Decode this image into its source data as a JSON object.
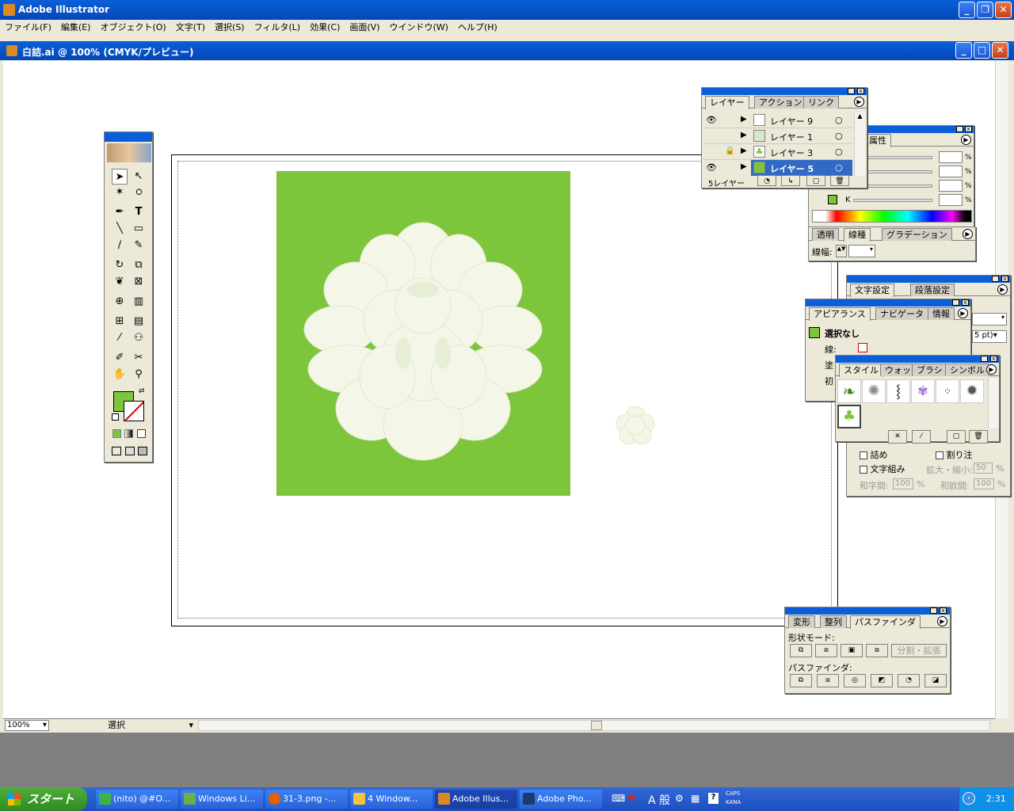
{
  "app": {
    "title": "Adobe Illustrator"
  },
  "menu": [
    "ファイル(F)",
    "編集(E)",
    "オブジェクト(O)",
    "文字(T)",
    "選択(S)",
    "フィルタ(L)",
    "効果(C)",
    "画面(V)",
    "ウインドウ(W)",
    "ヘルプ(H)"
  ],
  "document": {
    "title": "白詰.ai @ 100% (CMYK/プレビュー)"
  },
  "colors": {
    "artboard_green": "#7dc53b",
    "flower": "#f4f7e8",
    "titlebar": "#0a5fd8",
    "taskbar": "#245edb"
  },
  "layers": {
    "tabs": [
      "レイヤー",
      "アクション",
      "リンク"
    ],
    "rows": [
      {
        "name": "レイヤー 9",
        "visible": true,
        "locked": false
      },
      {
        "name": "レイヤー 1",
        "visible": false,
        "locked": false
      },
      {
        "name": "レイヤー 3",
        "visible": false,
        "locked": true
      },
      {
        "name": "レイヤー 5",
        "visible": true,
        "locked": false,
        "selected": true
      }
    ],
    "count": "5レイヤー"
  },
  "color_panel": {
    "tab": "属性",
    "channel_k": "K",
    "unit": "%"
  },
  "stroke_panel": {
    "tabs": [
      "透明",
      "線種",
      "グラデーション"
    ],
    "label": "線幅:"
  },
  "char_panel": {
    "tabs": [
      "文字設定",
      "段落設定"
    ],
    "value": "5 pt)",
    "options": {
      "tsume": "詰め",
      "wariate": "割り注",
      "mojigumi": "文字組み",
      "scale_label": "拡大・縮小:",
      "scale_value": "50",
      "wajikan": "和字間:",
      "wajikan_value": "100",
      "waoukan": "和欧間:",
      "waoukan_value": "100",
      "percent": "%"
    }
  },
  "appearance": {
    "tabs": [
      "アピアランス",
      "ナビゲータ",
      "情報"
    ],
    "selection": "選択なし",
    "stroke": "線:",
    "fill": "塗",
    "initial": "初"
  },
  "styles": {
    "tabs": [
      "スタイル",
      "ウォッチ",
      "ブラシ",
      "シンボル"
    ]
  },
  "pathfinder": {
    "tabs": [
      "変形",
      "整列",
      "パスファインダ"
    ],
    "shape_mode": "形状モード:",
    "expand": "分割・拡張",
    "pathfinder_label": "パスファインダ:"
  },
  "status": {
    "zoom": "100%",
    "tool": "選択"
  },
  "taskbar": {
    "start": "スタート",
    "tasks": [
      "(nito) @#O...",
      "Windows Li...",
      "31-3.png -...",
      "4 Window...",
      "Adobe Illus...",
      "Adobe Pho..."
    ],
    "ime": "A 般",
    "caps": "CAPS",
    "kana": "KANA",
    "clock": "2:31"
  }
}
